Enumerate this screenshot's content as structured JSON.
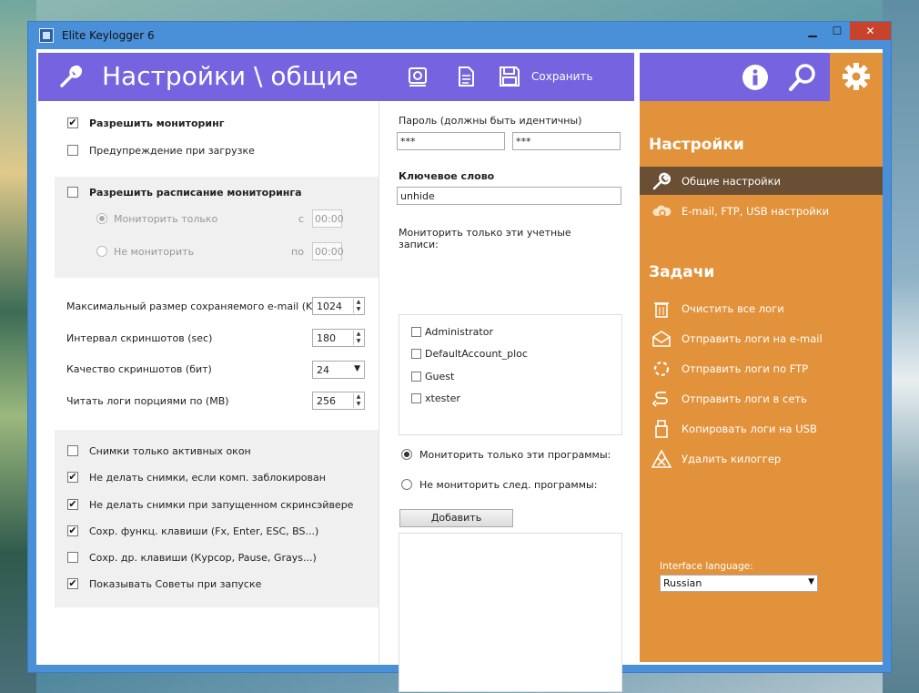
{
  "window": {
    "title": "Elite Keylogger 6",
    "controls": {
      "minimize": "▁",
      "maximize": "☐",
      "close": "✕"
    }
  },
  "header": {
    "title": "Настройки \\ общие",
    "save_label": "Сохранить",
    "icons": [
      "wrench-icon",
      "settings-gear-icon",
      "document-icon",
      "floppy-disk-icon"
    ]
  },
  "top_nav": {
    "icons": [
      "info-icon",
      "search-icon",
      "gear-icon"
    ]
  },
  "colors": {
    "header": "#7563e0",
    "sidebar": "#e2923a",
    "sidebar_active": "#6a4f35",
    "titlebar": "#4a90d9",
    "close": "#c9432c"
  },
  "sidebar": {
    "settings_heading": "Настройки",
    "settings_items": [
      {
        "label": "Общие настройки",
        "icon": "wrench-icon",
        "active": true
      },
      {
        "label": "E-mail, FTP, USB настройки",
        "icon": "cloud-gear-icon",
        "active": false
      }
    ],
    "tasks_heading": "Задачи",
    "task_items": [
      {
        "label": "Очистить все логи",
        "icon": "trash-icon"
      },
      {
        "label": "Отправить логи на e-mail",
        "icon": "envelope-icon"
      },
      {
        "label": "Отправить логи по FTP",
        "icon": "ftp-ring-icon"
      },
      {
        "label": "Отправить логи в сеть",
        "icon": "network-path-icon"
      },
      {
        "label": "Копировать логи на USB",
        "icon": "usb-icon"
      },
      {
        "label": "Удалить килоггер",
        "icon": "delete-cross-icon"
      }
    ],
    "language_label": "Interface language:",
    "language_value": "Russian"
  },
  "general": {
    "allow_monitoring": {
      "label": "Разрешить мониторинг",
      "checked": true
    },
    "boot_warning": {
      "label": "Предупреждение при загрузке",
      "checked": false
    },
    "schedule": {
      "label": "Разрешить расписание мониторинга",
      "checked": false,
      "monitor_only": {
        "label": "Мониторить только",
        "from_label": "с",
        "from_value": "00:00",
        "selected": true
      },
      "do_not_monitor": {
        "label": "Не мониторить",
        "to_label": "по",
        "to_value": "00:00",
        "selected": false
      }
    },
    "max_email_size": {
      "label": "Максимальный размер сохраняемого e-mail (KB)",
      "value": "1024"
    },
    "screenshot_interval": {
      "label": "Интервал скриншотов (sec)",
      "value": "180"
    },
    "screenshot_quality": {
      "label": "Качество скриншотов (бит)",
      "value": "24"
    },
    "read_logs_chunk": {
      "label": "Читать логи порциями по (MB)",
      "value": "256"
    },
    "options": [
      {
        "label": "Снимки только активных окон",
        "checked": false
      },
      {
        "label": "Не делать снимки, если комп. заблокирован",
        "checked": true
      },
      {
        "label": "Не делать снимки при запущенном скринсэйвере",
        "checked": true
      },
      {
        "label": "Сохр. функц. клавиши (Fx, Enter, ESC, BS...)",
        "checked": true
      },
      {
        "label": "Сохр. др. клавиши (Курсор, Pause, Grays...)",
        "checked": false
      },
      {
        "label": "Показывать Советы при запуске",
        "checked": true
      }
    ]
  },
  "security": {
    "password_label": "Пароль (должны быть идентичны)",
    "password_value": "***",
    "password_confirm_value": "***",
    "keyword_label": "Ключевое слово",
    "keyword_value": "unhide",
    "accounts_label_line1": "Мониторить только эти учетные",
    "accounts_label_line2": "записи:",
    "accounts": [
      {
        "label": "Administrator",
        "checked": false
      },
      {
        "label": "DefaultAccount_ploc",
        "checked": false
      },
      {
        "label": "Guest",
        "checked": false
      },
      {
        "label": "xtester",
        "checked": false
      }
    ],
    "program_mode_only": {
      "label": "Мониторить только эти программы:",
      "selected": true
    },
    "program_mode_except": {
      "label": "Не мониторить след. программы:",
      "selected": false
    },
    "add_button": "Добавить"
  }
}
